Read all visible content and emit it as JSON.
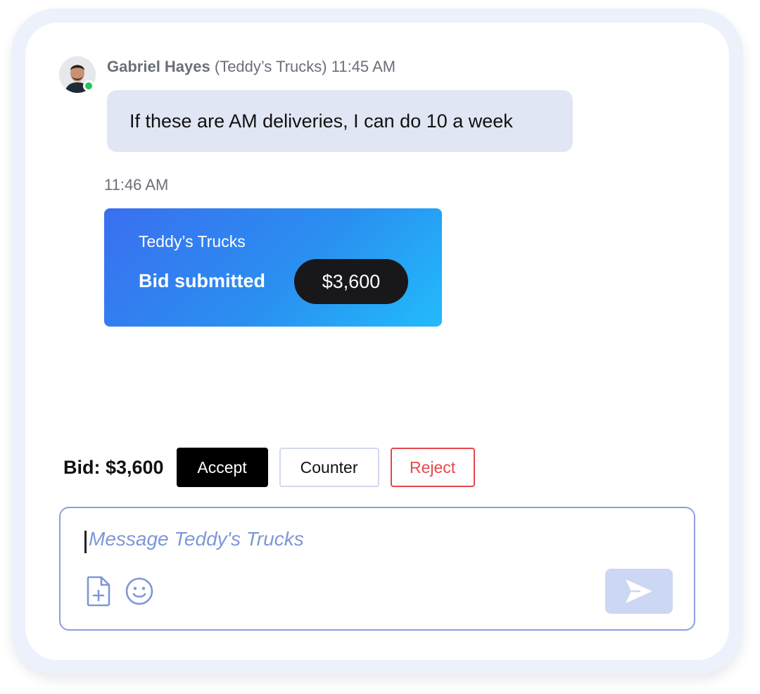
{
  "message": {
    "sender_name": "Gabriel Hayes",
    "sender_company": "(Teddy’s Trucks)",
    "time": "11:45 AM",
    "text": "If these are AM deliveries, I can do 10 a week",
    "online": true
  },
  "bid_event": {
    "time": "11:46 AM",
    "company": "Teddy’s Trucks",
    "status": "Bid submitted",
    "amount": "$3,600"
  },
  "bid_actions": {
    "label": "Bid: $3,600",
    "accept": "Accept",
    "counter": "Counter",
    "reject": "Reject"
  },
  "composer": {
    "placeholder": "Message Teddy's Trucks",
    "attach_icon": "file-plus-icon",
    "emoji_icon": "smiley-icon",
    "send_icon": "paper-plane-icon"
  },
  "colors": {
    "presence": "#22c55e",
    "bubble": "#e1e6f5",
    "reject": "#e5484d",
    "accent": "#8aa0df"
  }
}
